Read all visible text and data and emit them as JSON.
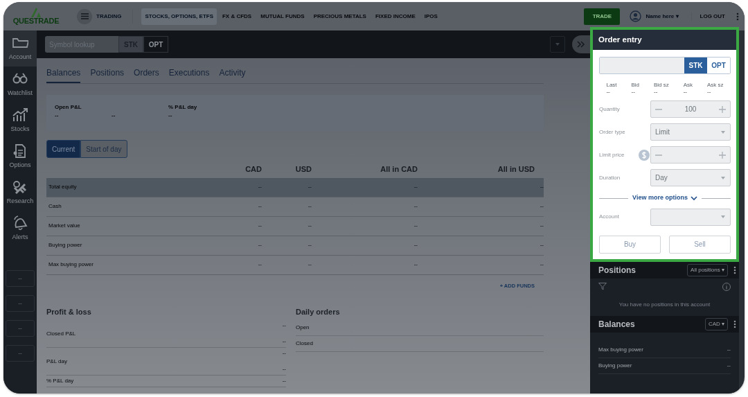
{
  "top_nav": {
    "logo": "QUESTRADE",
    "menu_label": "TRADING",
    "items": [
      {
        "label": "STOCKS, OPTIONS, ETFS",
        "selected": true
      },
      {
        "label": "FX & CFDS",
        "selected": false
      },
      {
        "label": "MUTUAL FUNDS",
        "selected": false
      },
      {
        "label": "PRECIOUS METALS",
        "selected": false
      },
      {
        "label": "FIXED INCOME",
        "selected": false
      },
      {
        "label": "IPOS",
        "selected": false
      }
    ],
    "trade_button": "TRADE",
    "user_name": "Name here ▾",
    "logout": "LOG OUT"
  },
  "sidebar": {
    "items": [
      {
        "label": "Account",
        "selected": true
      },
      {
        "label": "Watchlist",
        "selected": false
      },
      {
        "label": "Stocks",
        "selected": false
      },
      {
        "label": "Options",
        "selected": false
      },
      {
        "label": "Research",
        "selected": false
      },
      {
        "label": "Alerts",
        "selected": false
      }
    ],
    "boxes": [
      "--",
      "--",
      "--",
      "--"
    ]
  },
  "symbol_bar": {
    "placeholder": "Symbol lookup",
    "types": [
      {
        "label": "STK",
        "selected": true
      },
      {
        "label": "OPT",
        "selected": false
      }
    ]
  },
  "tabs": [
    {
      "label": "Balances",
      "selected": true
    },
    {
      "label": "Positions",
      "selected": false
    },
    {
      "label": "Orders",
      "selected": false
    },
    {
      "label": "Executions",
      "selected": false
    },
    {
      "label": "Activity",
      "selected": false
    }
  ],
  "summary": [
    {
      "label": "Open P&L",
      "values": [
        "--",
        "--"
      ]
    },
    {
      "label": "% P&L day",
      "values": [
        "--"
      ]
    }
  ],
  "view_toggle": [
    {
      "label": "Current",
      "selected": true
    },
    {
      "label": "Start of day",
      "selected": false
    }
  ],
  "table": {
    "columns": [
      "CAD",
      "USD",
      "All in CAD",
      "All in USD"
    ],
    "rows": [
      {
        "label": "Total equity",
        "values": [
          "--",
          "--",
          "--",
          "--"
        ],
        "selected": true
      },
      {
        "label": "Cash",
        "values": [
          "--",
          "--",
          "--",
          "--"
        ],
        "selected": false
      },
      {
        "label": "Market value",
        "values": [
          "--",
          "--",
          "--",
          "--"
        ],
        "selected": false
      },
      {
        "label": "Buying power",
        "values": [
          "--",
          "--",
          "--",
          "--"
        ],
        "selected": false
      },
      {
        "label": "Max buying power",
        "values": [
          "--",
          "--",
          "--",
          "--"
        ],
        "selected": false
      }
    ]
  },
  "add_funds": "+ ADD FUNDS",
  "profit_loss": {
    "title": "Profit & loss",
    "rows": [
      {
        "label": "Closed P&L",
        "values": [
          "--",
          "--"
        ]
      },
      {
        "label": "P&L day",
        "values": [
          "--",
          "--"
        ]
      },
      {
        "label": "% P&L day",
        "values": [
          "--"
        ]
      }
    ]
  },
  "daily_orders": {
    "title": "Daily orders",
    "rows": [
      {
        "label": "Open"
      },
      {
        "label": "Closed"
      }
    ]
  },
  "order_entry": {
    "title": "Order entry",
    "types": [
      {
        "label": "STK",
        "selected": true
      },
      {
        "label": "OPT",
        "selected": false
      }
    ],
    "quote": [
      {
        "label": "Last",
        "value": "--"
      },
      {
        "label": "Bid",
        "value": "--"
      },
      {
        "label": "Bid sz",
        "value": "--"
      },
      {
        "label": "Ask",
        "value": "--"
      },
      {
        "label": "Ask sz",
        "value": "--"
      }
    ],
    "fields": [
      {
        "label": "Quantity",
        "kind": "stepper",
        "value": "100"
      },
      {
        "label": "Order type",
        "kind": "select",
        "value": "Limit"
      },
      {
        "label": "Limit price",
        "kind": "price"
      },
      {
        "label": "Duration",
        "kind": "select",
        "value": "Day"
      }
    ],
    "more_options": "View more options",
    "account_fields": [
      {
        "label": "Account",
        "kind": "select"
      }
    ],
    "buttons": [
      "Buy",
      "Sell"
    ]
  },
  "positions": {
    "title": "Positions",
    "filter": "All positions ▾",
    "empty_message": "You have no positions in this account"
  },
  "balances": {
    "title": "Balances",
    "filter": "CAD ▾",
    "rows": [
      {
        "label": "Max buying power",
        "value": "--"
      },
      {
        "label": "Buying power",
        "value": "--"
      }
    ]
  }
}
